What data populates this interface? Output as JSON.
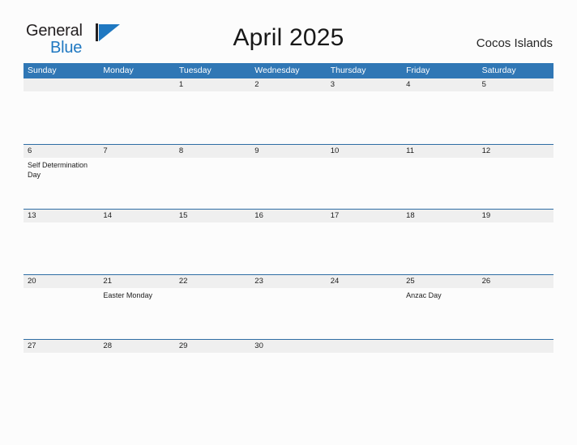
{
  "brand": {
    "name_part1": "General",
    "name_part2": "Blue",
    "accent_color": "#1f78c1",
    "mark_icon": "flag-triangle-icon"
  },
  "header": {
    "title": "April 2025",
    "locale": "Cocos Islands"
  },
  "theme": {
    "header_blue": "#3077b5",
    "row_rule_blue": "#2e6da4",
    "band_gray": "#efefef",
    "page_background": "#fcfcfc"
  },
  "calendar": {
    "month": "April",
    "year": "2025",
    "weekdays": [
      "Sunday",
      "Monday",
      "Tuesday",
      "Wednesday",
      "Thursday",
      "Friday",
      "Saturday"
    ],
    "weeks": [
      [
        {
          "day": "",
          "events": []
        },
        {
          "day": "",
          "events": []
        },
        {
          "day": "1",
          "events": []
        },
        {
          "day": "2",
          "events": []
        },
        {
          "day": "3",
          "events": []
        },
        {
          "day": "4",
          "events": []
        },
        {
          "day": "5",
          "events": []
        }
      ],
      [
        {
          "day": "6",
          "events": [
            "Self Determination Day"
          ]
        },
        {
          "day": "7",
          "events": []
        },
        {
          "day": "8",
          "events": []
        },
        {
          "day": "9",
          "events": []
        },
        {
          "day": "10",
          "events": []
        },
        {
          "day": "11",
          "events": []
        },
        {
          "day": "12",
          "events": []
        }
      ],
      [
        {
          "day": "13",
          "events": []
        },
        {
          "day": "14",
          "events": []
        },
        {
          "day": "15",
          "events": []
        },
        {
          "day": "16",
          "events": []
        },
        {
          "day": "17",
          "events": []
        },
        {
          "day": "18",
          "events": []
        },
        {
          "day": "19",
          "events": []
        }
      ],
      [
        {
          "day": "20",
          "events": []
        },
        {
          "day": "21",
          "events": [
            "Easter Monday"
          ]
        },
        {
          "day": "22",
          "events": []
        },
        {
          "day": "23",
          "events": []
        },
        {
          "day": "24",
          "events": []
        },
        {
          "day": "25",
          "events": [
            "Anzac Day"
          ]
        },
        {
          "day": "26",
          "events": []
        }
      ],
      [
        {
          "day": "27",
          "events": []
        },
        {
          "day": "28",
          "events": []
        },
        {
          "day": "29",
          "events": []
        },
        {
          "day": "30",
          "events": []
        },
        {
          "day": "",
          "events": []
        },
        {
          "day": "",
          "events": []
        },
        {
          "day": "",
          "events": []
        }
      ]
    ]
  }
}
